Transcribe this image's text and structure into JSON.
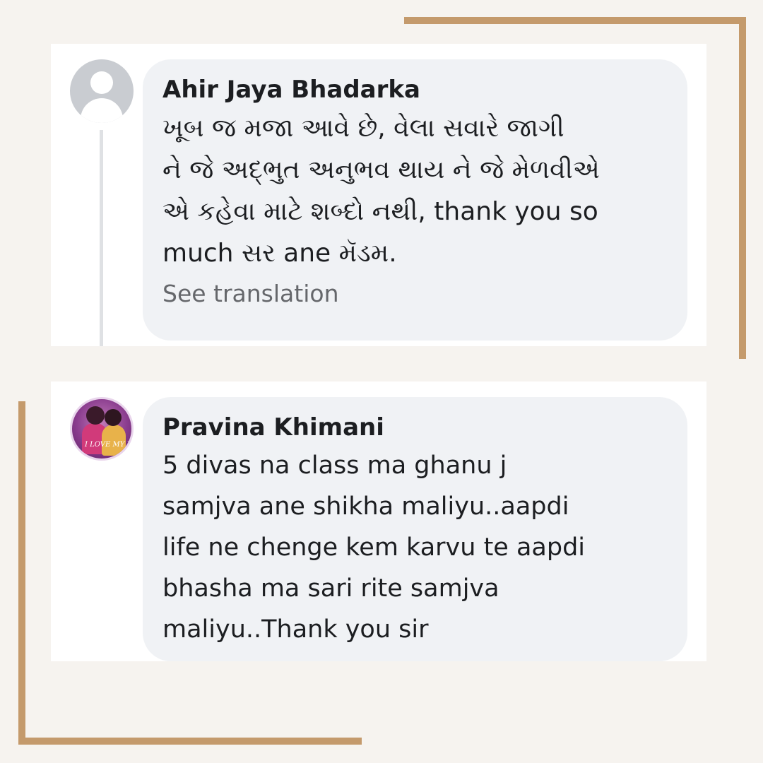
{
  "comments": [
    {
      "author": "Ahir Jaya Bhadarka",
      "text": "ખૂબ જ મજા  આવે છે, વેલા  સવારે જાગી\nને જે અદ્ભુત અનુભવ થાય ને જે મેળવીએ\nએ કહેવા માટે શબ્દો નથી, thank you so\nmuch સર ane મૅડમ.",
      "see_translation": "See translation",
      "avatar": "default-avatar-icon"
    },
    {
      "author": "Pravina Khimani",
      "text": "5 divas na class ma ghanu j\nsamjva ane  shikha maliyu..aapdi\nlife ne chenge kem karvu te aapdi\nbhasha ma sari rite samjva\nmaliyu..Thank you sir",
      "avatar": "profile-photo",
      "avatar_badge": "I LOVE MY Mom"
    }
  ],
  "colors": {
    "background": "#f6f3ef",
    "frame_gold": "#c49a6c",
    "bubble": "#f0f2f5",
    "text": "#1c1e21",
    "muted_text": "#65676b"
  }
}
